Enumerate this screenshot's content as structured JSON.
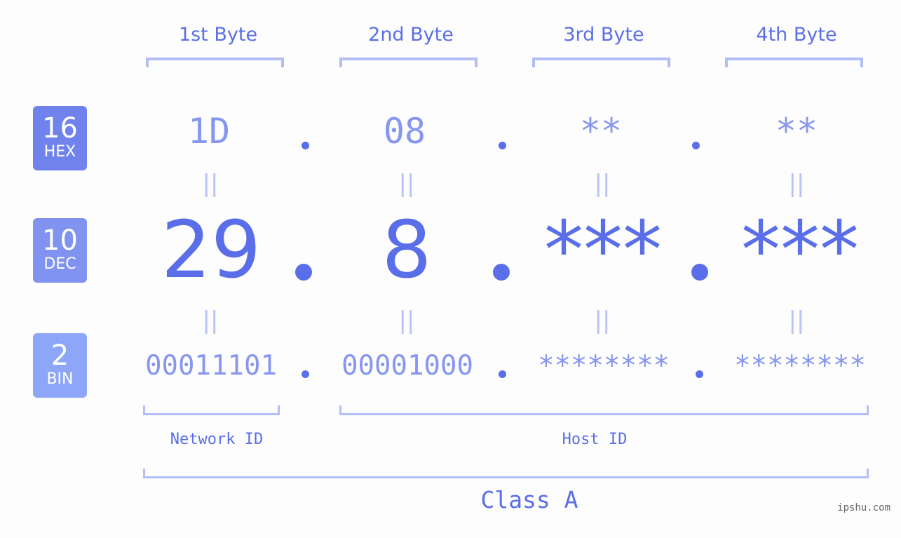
{
  "badges": {
    "hex": {
      "num": "16",
      "label": "HEX"
    },
    "dec": {
      "num": "10",
      "label": "DEC"
    },
    "bin": {
      "num": "2",
      "label": "BIN"
    }
  },
  "columns": [
    "1st Byte",
    "2nd Byte",
    "3rd Byte",
    "4th Byte"
  ],
  "hex": [
    "1D",
    "08",
    "**",
    "**"
  ],
  "dec": [
    "29",
    "8",
    "***",
    "***"
  ],
  "bin": [
    "00011101",
    "00001000",
    "********",
    "********"
  ],
  "equals_glyph": "||",
  "network_id_label": "Network ID",
  "host_id_label": "Host ID",
  "class_label": "Class A",
  "watermark": "ipshu.com",
  "colors": {
    "accent": "#5a6ee9",
    "hex_badge": "#7082ec",
    "dec_badge": "#8093f0",
    "bin_badge": "#8ea6f8",
    "bracket": "#b3bef6"
  }
}
